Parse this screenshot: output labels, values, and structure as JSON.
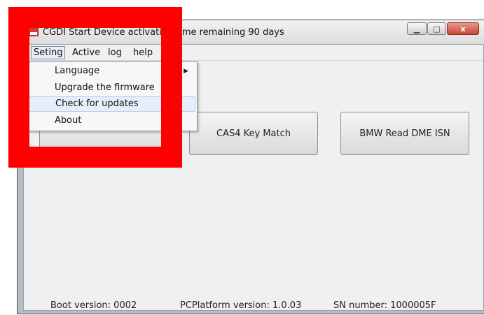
{
  "window": {
    "title": "CGDI Start        Device activation time remaining 90 days",
    "controls": {
      "minimize": "▁",
      "maximize": "□",
      "close": "x"
    }
  },
  "menubar": {
    "items": [
      "Seting",
      "Active",
      "log",
      "help"
    ]
  },
  "dropdown": {
    "items": [
      {
        "label": "Language",
        "has_submenu": true
      },
      {
        "label": "Upgrade the firmware"
      },
      {
        "label": "Check for updates",
        "highlighted": true
      },
      {
        "label": "About"
      }
    ],
    "submenu_arrow": "▶"
  },
  "buttons": {
    "cas4": "CAS4 Key Match",
    "bmw": "BMW Read DME ISN"
  },
  "status": {
    "boot": "Boot version: 0002",
    "pcplatform": "PCPlatform version:  1.0.03",
    "sn": "SN number:  1000005F"
  },
  "colors": {
    "annotation_red": "#ff0000",
    "close_button": "#c94535",
    "menu_highlight": "#e5eef9"
  }
}
